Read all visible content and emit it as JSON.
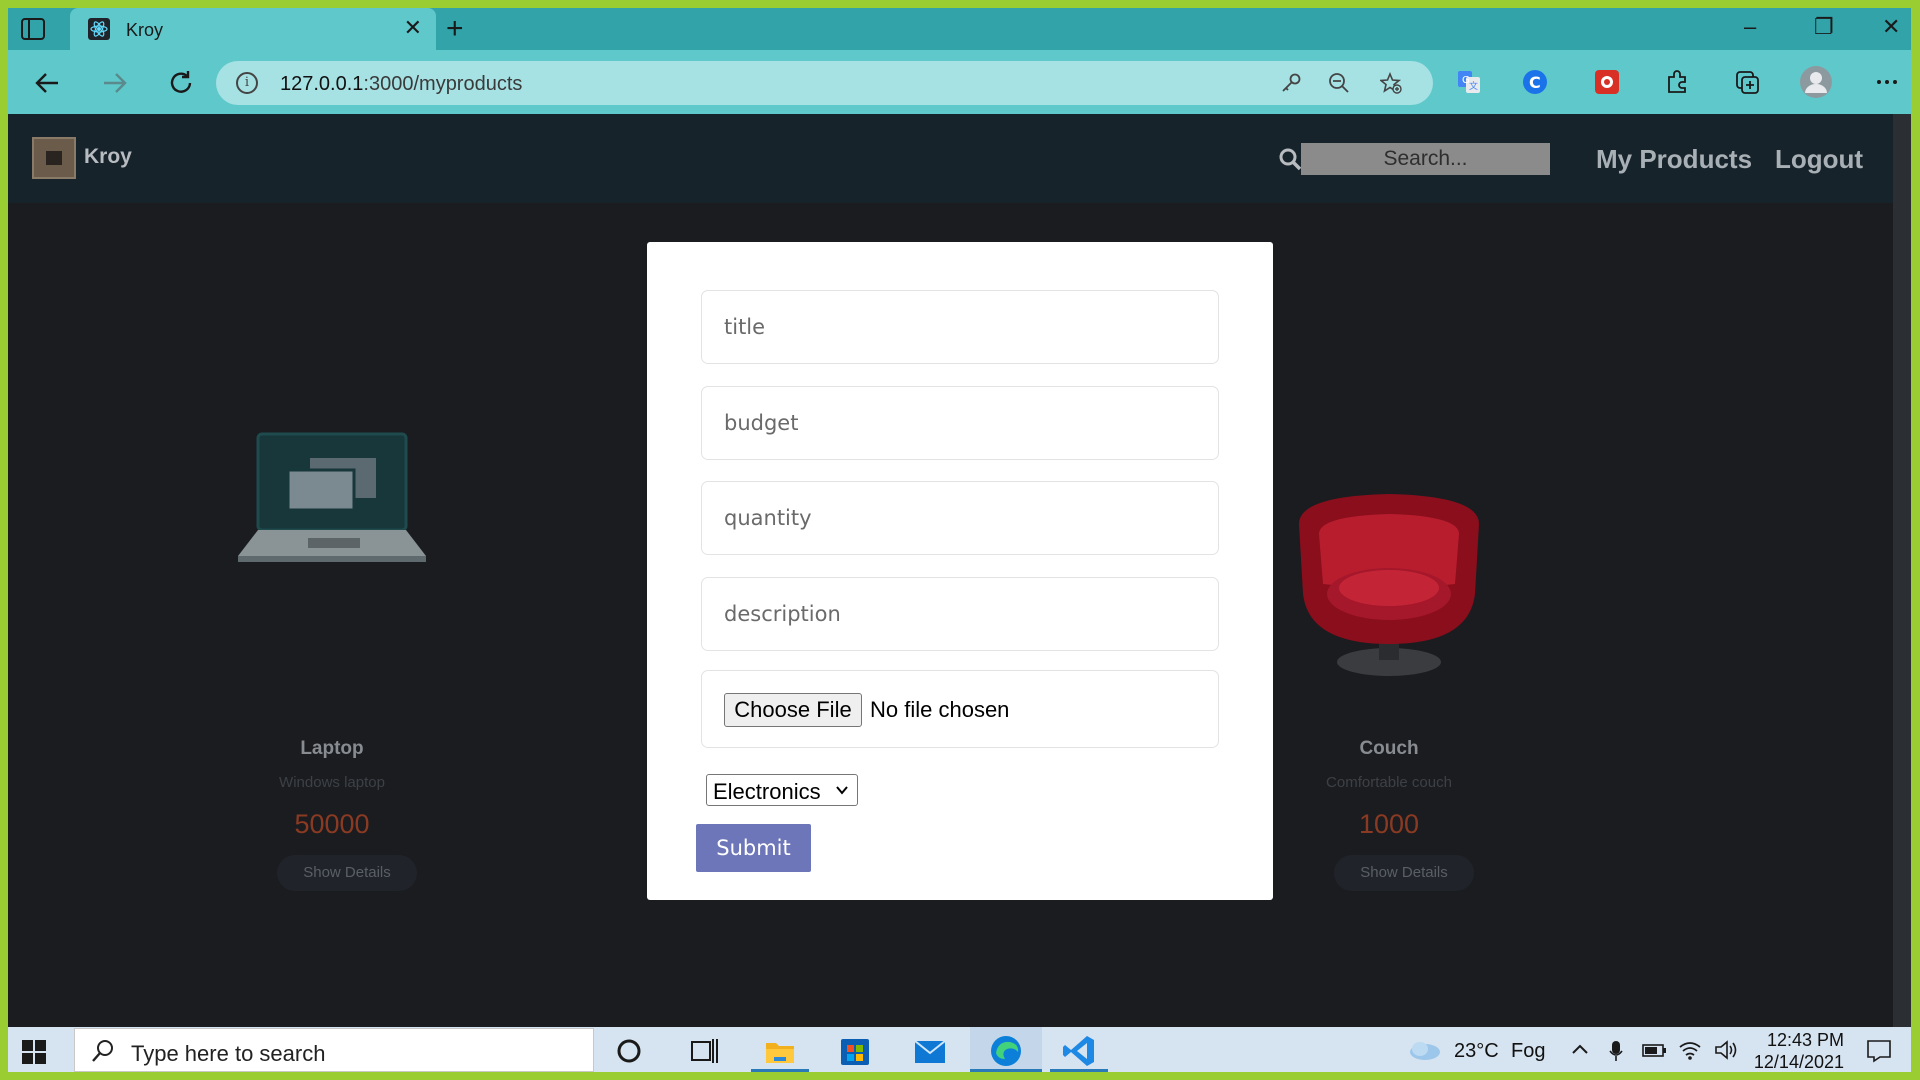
{
  "browser": {
    "tab_title": "Kroy",
    "url_host": "127.0.0.1",
    "url_path": ":3000/myproducts",
    "window_controls": {
      "minimize": "–",
      "restore": "❐",
      "close": "✕"
    },
    "new_tab": "+",
    "tab_close": "✕",
    "info_icon": "i"
  },
  "navbar": {
    "brand": "Kroy",
    "search_placeholder": "Search...",
    "links": [
      "My Products",
      "Logout"
    ]
  },
  "products": [
    {
      "title": "Laptop",
      "description": "Windows laptop",
      "price": "50000",
      "button": "Show Details",
      "image": "laptop-icon"
    },
    {
      "title": "Couch",
      "description": "Comfortable couch",
      "price": "1000",
      "button": "Show Details",
      "image": "armchair-image"
    }
  ],
  "form": {
    "placeholders": {
      "title": "title",
      "budget": "budget",
      "quantity": "quantity",
      "description": "description"
    },
    "file_button": "Choose File",
    "file_status": "No file chosen",
    "category_selected": "Electronics",
    "submit": "Submit"
  },
  "taskbar": {
    "search_placeholder": "Type here to search",
    "weather_temp": "23°C",
    "weather_desc": "Fog",
    "time": "12:43 PM",
    "date": "12/14/2021"
  },
  "colors": {
    "accent_submit": "#6d76b8",
    "price": "#8a3a22",
    "navbar_bg": "#16232b",
    "tab_bar": "#32a3a9"
  }
}
